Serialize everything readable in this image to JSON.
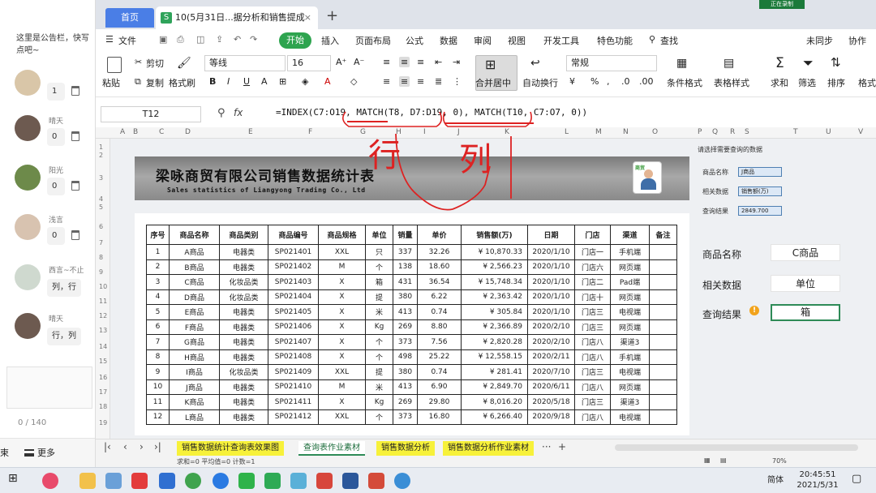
{
  "chat": {
    "notice": "这里是公告栏，快写点吧~",
    "messages": [
      {
        "user": "",
        "text": "1",
        "avatar_color": "#d9c6a8"
      },
      {
        "user": "晴天",
        "text": "0",
        "avatar_color": "#6d5a50"
      },
      {
        "user": "阳光",
        "text": "0",
        "avatar_color": "#6d8a4a"
      },
      {
        "user": "浅言",
        "text": "0",
        "avatar_color": "#d8c3b0"
      },
      {
        "user": "西言~不止",
        "text": "列，行",
        "avatar_color": "#cfd9cf"
      },
      {
        "user": "晴天",
        "text": "行，列",
        "avatar_color": "#6d5a50"
      }
    ],
    "char_count": "0 / 140",
    "end_label": "束",
    "more_label": "更多"
  },
  "tabs": {
    "home": "首页",
    "doc_title": "10(5月31日...据分析和销售提成",
    "recording": "正在录制"
  },
  "menu": {
    "file": "文件",
    "start": "开始",
    "items": [
      "插入",
      "页面布局",
      "公式",
      "数据",
      "审阅",
      "视图",
      "开发工具",
      "特色功能"
    ],
    "search": "查找",
    "sync": "未同步",
    "collab": "协作"
  },
  "ribbon": {
    "paste": "粘贴",
    "cut": "剪切",
    "copy": "复制",
    "format_painter": "格式刷",
    "font": "等线",
    "size": "16",
    "merge": "合并居中",
    "wrap": "自动换行",
    "number_format": "常规",
    "cond_format": "条件格式",
    "table_style": "表格样式",
    "sum": "求和",
    "filter": "筛选",
    "sort": "排序",
    "format": "格式"
  },
  "formula_bar": {
    "cell": "T12",
    "fx": "fx",
    "formula": "=INDEX(C7:O19, MATCH(T8, D7:D19, 0), MATCH(T10, C7:O7, 0))"
  },
  "columns": [
    "A",
    "B",
    "C",
    "D",
    "E",
    "F",
    "G",
    "H",
    "I",
    "J",
    "K",
    "L",
    "M",
    "N",
    "O",
    "P",
    "Q",
    "R",
    "S",
    "T",
    "U",
    "V"
  ],
  "rows": [
    "1",
    "2",
    "3",
    "4",
    "5",
    "6",
    "7",
    "8",
    "9",
    "10",
    "11",
    "12",
    "13",
    "14",
    "15",
    "16",
    "17",
    "18",
    "19"
  ],
  "banner": {
    "title": "梁咏商贸有限公司销售数据统计表",
    "subtitle": "Sales statistics of Liangyong Trading Co., Ltd",
    "logo_text": "商贸"
  },
  "table": {
    "headers": [
      "序号",
      "商品名称",
      "商品类别",
      "商品编号",
      "商品规格",
      "单位",
      "销量",
      "单价",
      "销售额(万)",
      "日期",
      "门店",
      "渠道",
      "备注"
    ],
    "rows": [
      [
        "1",
        "A商品",
        "电器类",
        "SP021401",
        "XXL",
        "只",
        "337",
        "32.26",
        "¥ 10,870.33",
        "2020/1/10",
        "门店一",
        "手机端",
        ""
      ],
      [
        "2",
        "B商品",
        "电器类",
        "SP021402",
        "M",
        "个",
        "138",
        "18.60",
        "¥ 2,566.23",
        "2020/1/10",
        "门店六",
        "网页端",
        ""
      ],
      [
        "3",
        "C商品",
        "化妆品类",
        "SP021403",
        "X",
        "箱",
        "431",
        "36.54",
        "¥ 15,748.34",
        "2020/1/10",
        "门店二",
        "Pad端",
        ""
      ],
      [
        "4",
        "D商品",
        "化妆品类",
        "SP021404",
        "X",
        "提",
        "380",
        "6.22",
        "¥ 2,363.42",
        "2020/1/10",
        "门店十",
        "网页端",
        ""
      ],
      [
        "5",
        "E商品",
        "电器类",
        "SP021405",
        "X",
        "米",
        "413",
        "0.74",
        "¥ 305.84",
        "2020/1/10",
        "门店三",
        "电视端",
        ""
      ],
      [
        "6",
        "F商品",
        "电器类",
        "SP021406",
        "X",
        "Kg",
        "269",
        "8.80",
        "¥ 2,366.89",
        "2020/2/10",
        "门店三",
        "网页端",
        ""
      ],
      [
        "7",
        "G商品",
        "电器类",
        "SP021407",
        "X",
        "个",
        "373",
        "7.56",
        "¥ 2,820.28",
        "2020/2/10",
        "门店八",
        "渠道3",
        ""
      ],
      [
        "8",
        "H商品",
        "电器类",
        "SP021408",
        "X",
        "个",
        "498",
        "25.22",
        "¥ 12,558.15",
        "2020/2/11",
        "门店八",
        "手机端",
        ""
      ],
      [
        "9",
        "I商品",
        "化妆品类",
        "SP021409",
        "XXL",
        "提",
        "380",
        "0.74",
        "¥ 281.41",
        "2020/7/10",
        "门店三",
        "电视端",
        ""
      ],
      [
        "10",
        "J商品",
        "电器类",
        "SP021410",
        "M",
        "米",
        "413",
        "6.90",
        "¥ 2,849.70",
        "2020/6/11",
        "门店八",
        "网页端",
        ""
      ],
      [
        "11",
        "K商品",
        "电器类",
        "SP021411",
        "X",
        "Kg",
        "269",
        "29.80",
        "¥ 8,016.20",
        "2020/5/18",
        "门店三",
        "渠道3",
        ""
      ],
      [
        "12",
        "L商品",
        "电器类",
        "SP021412",
        "XXL",
        "个",
        "373",
        "16.80",
        "¥ 6,266.40",
        "2020/9/18",
        "门店八",
        "电视端",
        ""
      ]
    ]
  },
  "query_small": {
    "caption": "请选择需要查询的数据",
    "rows": [
      {
        "label": "商品名称",
        "value": "J商品"
      },
      {
        "label": "相关数据",
        "value": "销售额(万)"
      },
      {
        "label": "查询结果",
        "value": "2849.700"
      }
    ]
  },
  "query": {
    "name_label": "商品名称",
    "name_value": "C商品",
    "data_label": "相关数据",
    "data_value": "单位",
    "result_label": "查询结果",
    "result_value": "箱",
    "warn": "!"
  },
  "annotations": {
    "row": "行",
    "col": "列"
  },
  "sheet_tabs": [
    "销售数据统计查询表效果图",
    "查询表作业素材",
    "销售数据分析",
    "销售数据分析作业素材"
  ],
  "status": "求和=0  平均值=0  计数=1",
  "zoom": "70%",
  "taskbar": {
    "time": "20:45:51",
    "date": "2021/5/31",
    "ime": "简体"
  }
}
